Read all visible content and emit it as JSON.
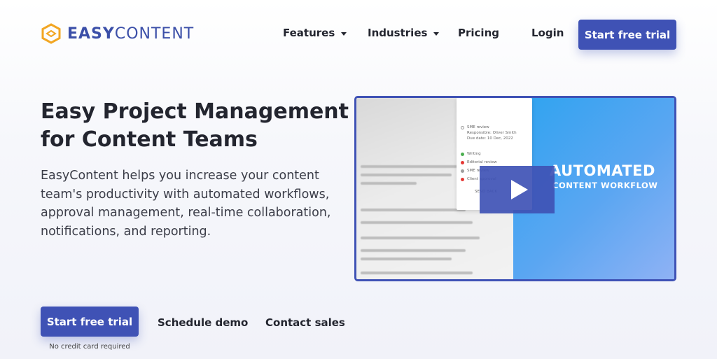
{
  "header": {
    "logo_text_bold": "EASY",
    "logo_text_light": "CONTENT",
    "nav": [
      {
        "label": "Features",
        "has_dropdown": true
      },
      {
        "label": "Industries",
        "has_dropdown": true
      },
      {
        "label": "Pricing",
        "has_dropdown": false
      },
      {
        "label": "Login",
        "has_dropdown": false
      }
    ],
    "cta_label": "Start free trial"
  },
  "hero": {
    "title": "Easy Project Management for Content Teams",
    "description": "EasyContent helps you increase your content team's productivity with automated workflows, approval management, real-time collaboration, notifications, and reporting.",
    "primary_cta": "Start free trial",
    "secondary_cta_1": "Schedule demo",
    "secondary_cta_2": "Contact sales",
    "cta_note": "No credit card required"
  },
  "video": {
    "overlay_title": "AUTOMATED",
    "overlay_subtitle": "CONTENT WORKFLOW",
    "panel_items": [
      {
        "label": "Writing",
        "color": "#4caf50"
      },
      {
        "label": "Editorial review",
        "color": "#e53935"
      },
      {
        "label": "SME review",
        "color": "#9e9e9e"
      },
      {
        "label": "Client approval",
        "color": "#e53935"
      }
    ],
    "panel_heading": "SME review",
    "panel_meta_1": "Responsible: Oliver Smith",
    "panel_meta_2": "Due date: 10 Dec, 2022",
    "panel_button": "SEND BACK"
  },
  "colors": {
    "brand": "#3f52b5",
    "logo_icon": "#f2a623"
  },
  "icons": {
    "logo": "hexagon-logo-icon",
    "play": "play-icon",
    "dropdown": "caret-down-icon"
  }
}
